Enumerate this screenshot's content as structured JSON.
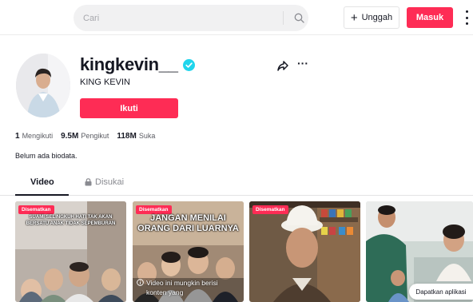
{
  "search": {
    "placeholder": "Cari"
  },
  "header": {
    "upload_label": "Unggah",
    "login_label": "Masuk"
  },
  "profile": {
    "username": "kingkevin__",
    "display_name": "KING KEVIN",
    "follow_label": "Ikuti",
    "stats": [
      {
        "value": "1",
        "label": "Mengikuti"
      },
      {
        "value": "9.5M",
        "label": "Pengikut"
      },
      {
        "value": "118M",
        "label": "Suka"
      }
    ],
    "bio": "Belum ada biodata."
  },
  "tabs": {
    "video": "Video",
    "liked": "Disukai"
  },
  "videos": [
    {
      "badge": "Disematkan",
      "caption": "SUAMI SELINGKUH HATI TAK AKAN BERSATU ANAK TIDAK SEPEMBURAN"
    },
    {
      "badge": "Disematkan",
      "caption": "JANGAN MENILAI ORANG DARI LUARNYA",
      "warning": "Video ini mungkin berisi konten yang"
    },
    {
      "badge": "Disematkan"
    },
    {}
  ],
  "get_app_label": "Dapatkan aplikasi",
  "colors": {
    "accent": "#fe2c55",
    "verified": "#20d5ec"
  }
}
